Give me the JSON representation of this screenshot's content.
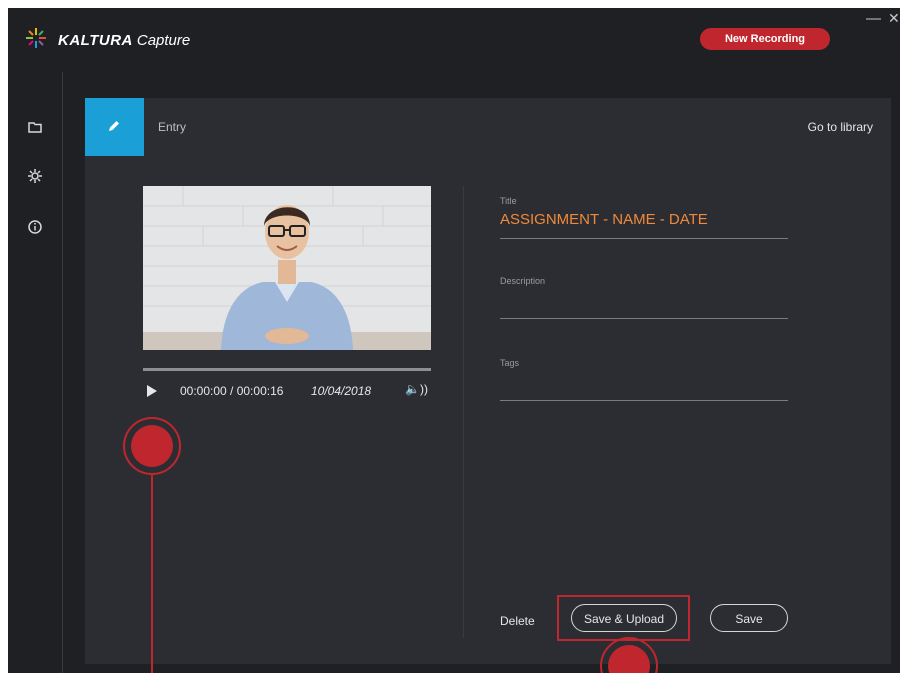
{
  "app": {
    "logo_brand": "KALTURA",
    "logo_product": "Capture",
    "new_recording_label": "New Recording",
    "minimize_glyph": "—",
    "close_glyph": "✕"
  },
  "sidebar": {
    "items": [
      {
        "name": "library",
        "icon": "folder-icon"
      },
      {
        "name": "settings",
        "icon": "gear-icon"
      },
      {
        "name": "info",
        "icon": "info-icon"
      }
    ]
  },
  "entry": {
    "tab_label": "Entry",
    "go_to_library": "Go to library",
    "player": {
      "time": "00:00:00 / 00:00:16",
      "date": "10/04/2018",
      "volume_glyph": "🔈))"
    },
    "fields": {
      "title_label": "Title",
      "title_value": "ASSIGNMENT - NAME - DATE",
      "description_label": "Description",
      "description_value": "",
      "tags_label": "Tags",
      "tags_value": ""
    },
    "actions": {
      "delete": "Delete",
      "save_upload": "Save & Upload",
      "save": "Save"
    }
  },
  "colors": {
    "accent_blue": "#1aa0d6",
    "brand_red": "#c0262d",
    "title_orange": "#f08a3a",
    "panel": "#2c2d33",
    "background": "#1f2024"
  }
}
